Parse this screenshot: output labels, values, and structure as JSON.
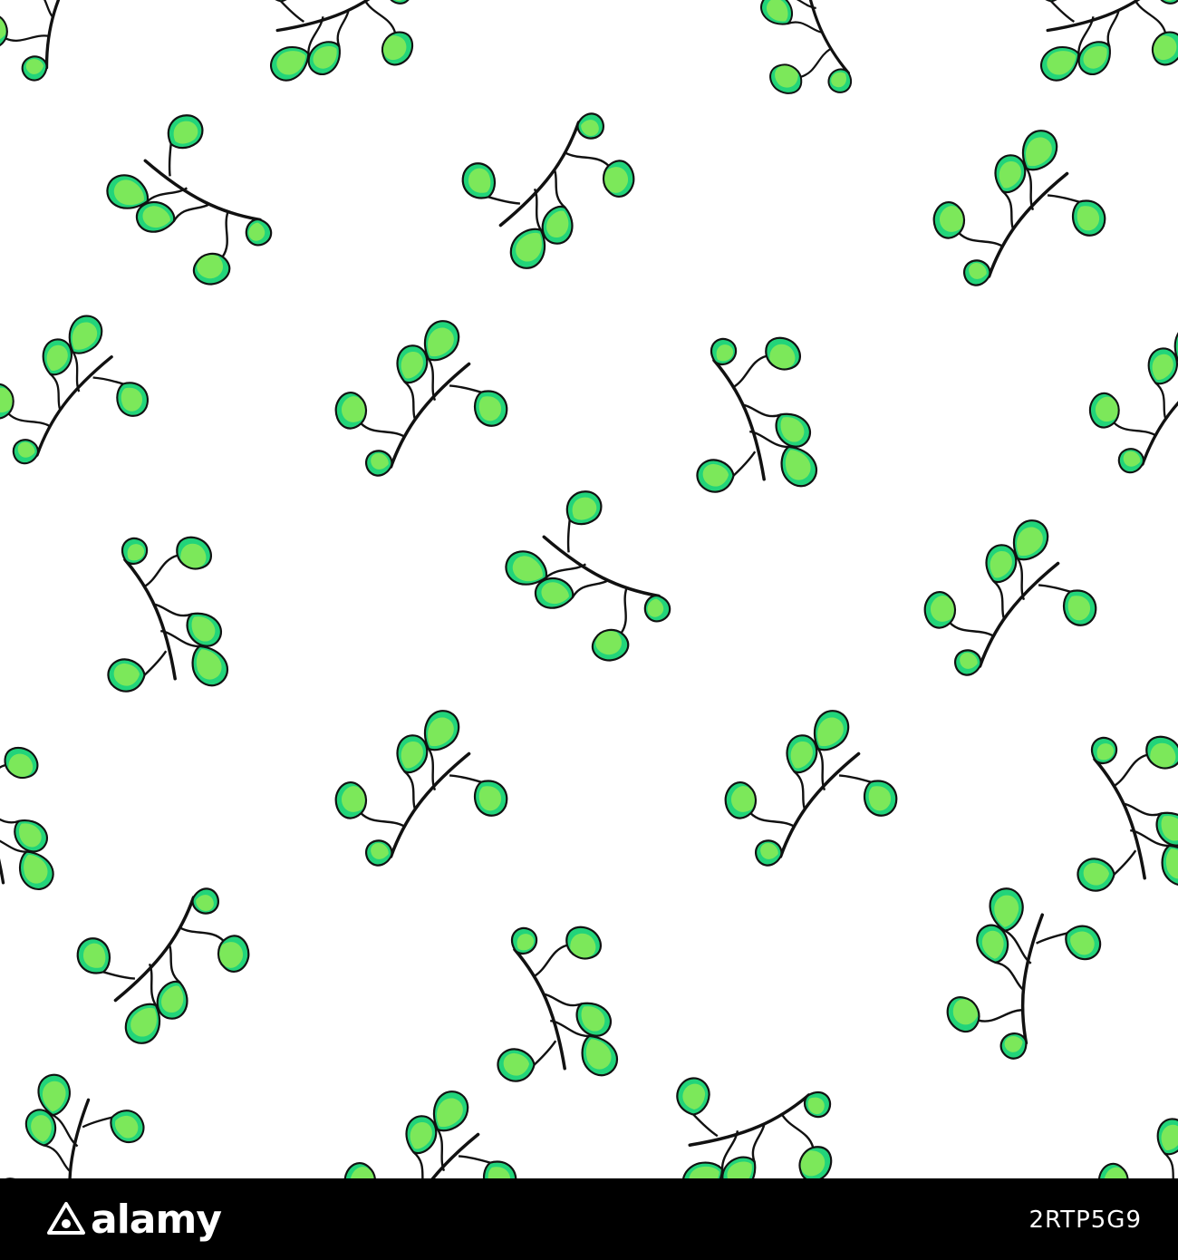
{
  "image": {
    "subject": "sprig",
    "colors": {
      "background": "#ffffff",
      "leaf_light": "#7ce85a",
      "leaf_edge": "#22d47a",
      "outline": "#111111",
      "footer": "#000000",
      "footer_text": "#ffffff"
    }
  },
  "watermark": {
    "logo_text": "alamy",
    "logo_icon": "alamy-logo-icon",
    "image_id": "2RTP5G9"
  }
}
